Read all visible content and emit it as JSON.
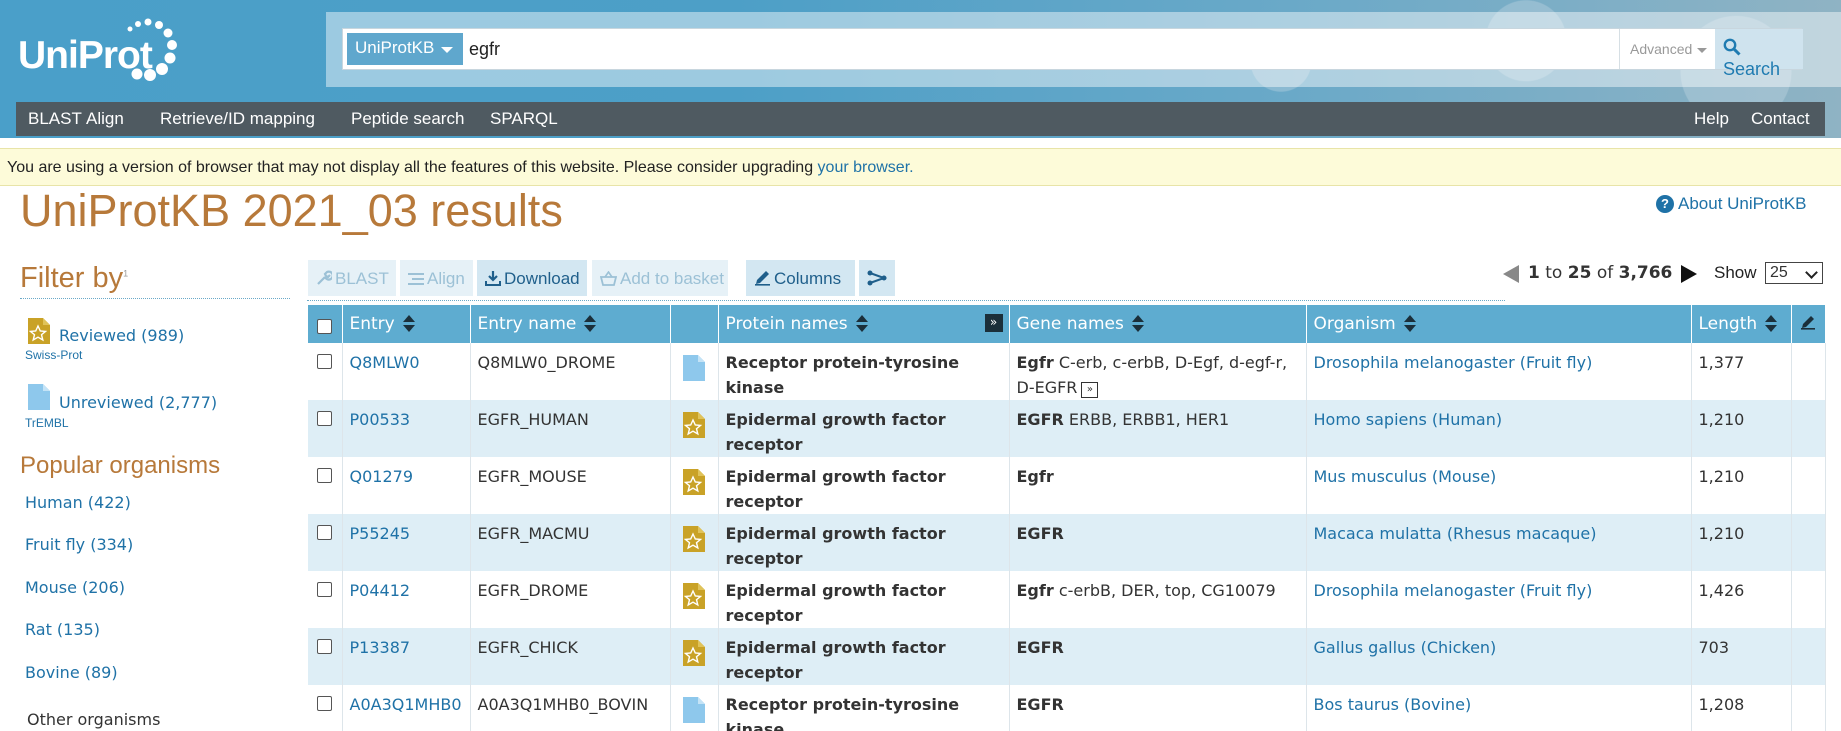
{
  "header": {
    "logo_text": "UniProt",
    "search": {
      "database": "UniProtKB",
      "query": "egfr",
      "advanced_label": "Advanced",
      "button_label": "Search"
    },
    "nav_left": [
      "BLAST",
      "Align",
      "Retrieve/ID mapping",
      "Peptide search",
      "SPARQL"
    ],
    "nav_right": [
      "Help",
      "Contact"
    ]
  },
  "banner": {
    "text": "You are using a version of browser that may not display all the features of this website. Please consider upgrading ",
    "link": "your browser."
  },
  "page_title": "UniProtKB 2021_03 results",
  "about_link": "About UniProtKB",
  "sidebar": {
    "filter_title": "Filter by",
    "filter_sup": "1",
    "reviewed": {
      "label": "Reviewed (989)",
      "sub": "Swiss-Prot"
    },
    "unreviewed": {
      "label": "Unreviewed (2,777)",
      "sub": "TrEMBL"
    },
    "popular_title": "Popular organisms",
    "organisms": [
      "Human (422)",
      "Fruit fly (334)",
      "Mouse (206)",
      "Rat (135)",
      "Bovine (89)"
    ],
    "other_organisms": "Other organisms"
  },
  "toolbar": {
    "blast": "BLAST",
    "align": "Align",
    "download": "Download",
    "add_basket": "Add to basket",
    "columns": "Columns"
  },
  "pager": {
    "from": "1",
    "to_word": "to",
    "to": "25",
    "of_word": "of",
    "total": "3,766",
    "show_label": "Show",
    "show_value": "25"
  },
  "table": {
    "headers": {
      "entry": "Entry",
      "entry_name": "Entry name",
      "protein_names": "Protein names",
      "gene_names": "Gene names",
      "organism": "Organism",
      "length": "Length"
    },
    "rows": [
      {
        "entry": "Q8MLW0",
        "entry_name": "Q8MLW0_DROME",
        "status": "unreviewed",
        "protein": "Receptor protein-tyrosine kinase",
        "gene_primary": "Egfr",
        "gene_other": "C-erb, c-erbB, D-Egf, d-egf-r, D-EGFR",
        "gene_more": "»",
        "organism": "Drosophila melanogaster (Fruit fly)",
        "length": "1,377"
      },
      {
        "entry": "P00533",
        "entry_name": "EGFR_HUMAN",
        "status": "reviewed",
        "protein": "Epidermal growth factor receptor",
        "gene_primary": "EGFR",
        "gene_other": "ERBB, ERBB1, HER1",
        "gene_more": "",
        "organism": "Homo sapiens (Human)",
        "length": "1,210"
      },
      {
        "entry": "Q01279",
        "entry_name": "EGFR_MOUSE",
        "status": "reviewed",
        "protein": "Epidermal growth factor receptor",
        "gene_primary": "Egfr",
        "gene_other": "",
        "gene_more": "",
        "organism": "Mus musculus (Mouse)",
        "length": "1,210"
      },
      {
        "entry": "P55245",
        "entry_name": "EGFR_MACMU",
        "status": "reviewed",
        "protein": "Epidermal growth factor receptor",
        "gene_primary": "EGFR",
        "gene_other": "",
        "gene_more": "",
        "organism": "Macaca mulatta (Rhesus macaque)",
        "length": "1,210"
      },
      {
        "entry": "P04412",
        "entry_name": "EGFR_DROME",
        "status": "reviewed",
        "protein": "Epidermal growth factor receptor",
        "gene_primary": "Egfr",
        "gene_other": "c-erbB, DER, top, CG10079",
        "gene_more": "",
        "organism": "Drosophila melanogaster (Fruit fly)",
        "length": "1,426"
      },
      {
        "entry": "P13387",
        "entry_name": "EGFR_CHICK",
        "status": "reviewed",
        "protein": "Epidermal growth factor receptor",
        "gene_primary": "EGFR",
        "gene_other": "",
        "gene_more": "",
        "organism": "Gallus gallus (Chicken)",
        "length": "703"
      },
      {
        "entry": "A0A3Q1MHB0",
        "entry_name": "A0A3Q1MHB0_BOVIN",
        "status": "unreviewed",
        "protein": "Receptor protein-tyrosine kinase",
        "gene_primary": "EGFR",
        "gene_other": "",
        "gene_more": "",
        "organism": "Bos taurus (Bovine)",
        "length": "1,208"
      }
    ]
  },
  "colors": {
    "brand_orange": "#b7793a",
    "link_blue": "#1f72a7",
    "header_blue": "#5eacd0",
    "reviewed_gold": "#c9a227",
    "unreviewed_blue": "#8ec8ec"
  }
}
